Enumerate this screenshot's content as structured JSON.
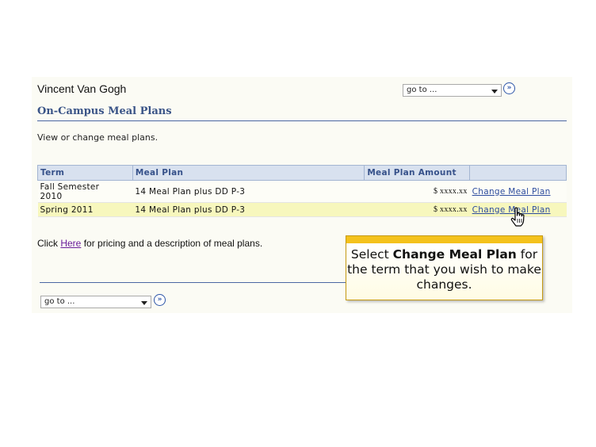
{
  "user_name": "Vincent Van Gogh",
  "goto_top": {
    "value": "go to ..."
  },
  "goto_bottom": {
    "value": "go to ..."
  },
  "go_button_glyph": "»",
  "page_title": "On-Campus Meal Plans",
  "description": "View or change meal plans.",
  "table": {
    "headers": [
      "Term",
      "Meal Plan",
      "Meal Plan Amount",
      ""
    ],
    "rows": [
      {
        "term_line1": "Fall Semester",
        "term_line2": "2010",
        "meal_plan": "14 Meal Plan plus DD P-3",
        "amount": "$ xxxx.xx",
        "action": "Change Meal Plan"
      },
      {
        "term_line1": "Spring 2011",
        "term_line2": "",
        "meal_plan": "14 Meal Plan plus DD P-3",
        "amount": "$ xxxx.xx",
        "action": "Change Meal Plan"
      }
    ]
  },
  "pricing": {
    "prefix": "Click ",
    "link": "Here",
    "suffix": " for pricing and a description of meal plans."
  },
  "callout": {
    "part1": "Select ",
    "bold": "Change Meal Plan",
    "part2": " for the term that you wish to make changes."
  },
  "colors": {
    "accent": "#3a5487",
    "callout_bar": "#f4c21c",
    "row_highlight": "#f7f7bd",
    "header_bg": "#d8e1ef"
  },
  "icons": {
    "go": "double-chevron-right-icon",
    "cursor": "hand-pointer-icon",
    "dropdown": "caret-down-icon"
  }
}
